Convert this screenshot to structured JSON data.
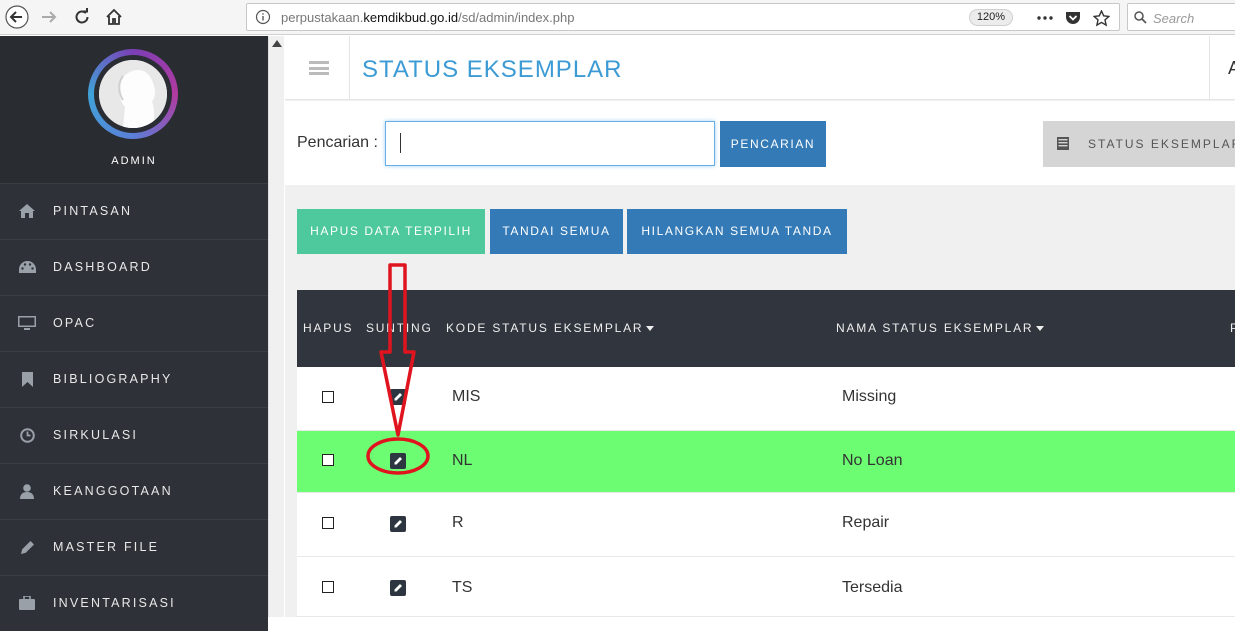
{
  "browser": {
    "url_prefix": "perpustakaan.",
    "url_domain": "kemdikbud.go.id",
    "url_path": "/sd/admin/index.php",
    "zoom": "120%",
    "search_placeholder": "Search"
  },
  "sidebar": {
    "user_label": "ADMIN",
    "items": [
      {
        "label": "PINTASAN",
        "icon": "home-icon"
      },
      {
        "label": "DASHBOARD",
        "icon": "dashboard-icon"
      },
      {
        "label": "OPAC",
        "icon": "monitor-icon"
      },
      {
        "label": "BIBLIOGRAPHY",
        "icon": "bookmark-icon"
      },
      {
        "label": "SIRKULASI",
        "icon": "clock-icon"
      },
      {
        "label": "KEANGGOTAAN",
        "icon": "user-icon"
      },
      {
        "label": "MASTER FILE",
        "icon": "pencil-icon"
      },
      {
        "label": "INVENTARISASI",
        "icon": "briefcase-icon"
      }
    ]
  },
  "header": {
    "title": "STATUS EKSEMPLAR",
    "user_initial": "A"
  },
  "search": {
    "label": "Pencarian :",
    "value": "",
    "button": "PENCARIAN",
    "status_button": "STATUS EKSEMPLAR"
  },
  "actions": {
    "delete_selected": "HAPUS DATA TERPILIH",
    "mark_all": "TANDAI SEMUA",
    "unmark_all": "HILANGKAN SEMUA TANDA"
  },
  "table": {
    "columns": {
      "delete": "HAPUS",
      "edit": "SUNTING",
      "code": "KODE STATUS EKSEMPLAR",
      "name": "NAMA STATUS EKSEMPLAR",
      "extra": "P"
    },
    "rows": [
      {
        "code": "MIS",
        "name": "Missing",
        "highlighted": false
      },
      {
        "code": "NL",
        "name": "No Loan",
        "highlighted": true
      },
      {
        "code": "R",
        "name": "Repair",
        "highlighted": false
      },
      {
        "code": "TS",
        "name": "Tersedia",
        "highlighted": false
      }
    ]
  },
  "colors": {
    "accent": "#3c9bd4",
    "primary_button": "#337ab7",
    "success_button": "#4ec99d",
    "highlight_row": "#6dfd73",
    "sidebar_bg": "#2a2d33",
    "annotation": "#e0141e"
  }
}
